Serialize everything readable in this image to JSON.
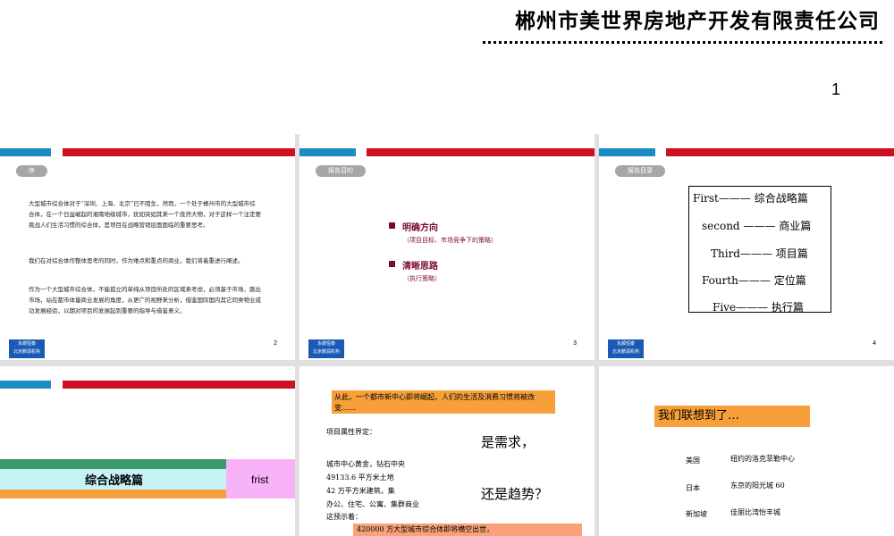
{
  "header": {
    "company": "郴州市美世界房地产开发有限责任公司",
    "page_number": "1"
  },
  "footer_brand": {
    "line1": "永顺恒泰",
    "line2": "北京鹏润机构"
  },
  "slides": [
    {
      "tag": "序",
      "number": "2",
      "paragraphs": [
        "大型城市综合体对于“深圳、上海、北京”已不陌生，然而，一个处于郴州市的大型城市综合体，在一个日益崛起的湘南地级城市，犹如突如其来一个庞然大物，对于这样一个注定要挑战人们生活习惯的综合体，是项目在战略营销层面面临的重要思考。",
        "我们在对综合体作整体思考的同时，作为难点和重点的商业，我们将着重进行阐述。",
        "作为一个大型城市综合体，不能孤立的单纯从项目所处的区域来考虑，必须基于市场，跳出市场，站在都市体量商业发展的角度，从更广的视野来分析，借鉴国际国内其它同类物业成功发展经验，以期对项目的发展起到重要的指导与借鉴意义。"
      ]
    },
    {
      "tag": "报告目的",
      "number": "3",
      "items": [
        {
          "head": "明确方向",
          "sub": "（项目目标、市场竞争下的策略）"
        },
        {
          "head": "清晰思路",
          "sub": "（执行策略）"
        }
      ]
    },
    {
      "tag": "报告目录",
      "number": "4",
      "toc": [
        "First——— 综合战略篇",
        "second ——— 商业篇",
        "Third——— 项目篇",
        "Fourth——— 定位篇",
        "Five——— 执行篇"
      ]
    },
    {
      "title": "综合战略篇",
      "side": "frist"
    },
    {
      "banner": "从此，一个都市新中心即将崛起，人们的生活及消费习惯将被改变……",
      "label": "项目属性界定：",
      "big1": "是需求，",
      "big2": "还是趋势？",
      "lines": [
        "城市中心黄金，钻石中央",
        "49133.6 平方米土地",
        "42 万平方米建筑，集",
        "办公、住宅、公寓、集群商业",
        "这预示着："
      ],
      "bottom": "420000 方大型城市综合体即将横空出世，"
    },
    {
      "title": "我们联想到了…",
      "rows": [
        {
          "country": "美国",
          "place": "纽约的洛克菲勒中心"
        },
        {
          "country": "日本",
          "place": "东京的阳光城 60"
        },
        {
          "country": "新加坡",
          "place": "佳丽比湾怡丰城"
        }
      ]
    }
  ],
  "colors": {
    "blue": "#1a8cc4",
    "red": "#cc1122",
    "maroon": "#7a0a2a",
    "orange": "#f7a03a"
  }
}
